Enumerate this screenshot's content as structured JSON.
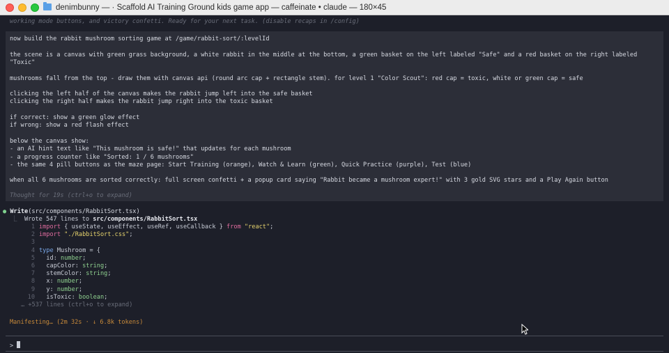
{
  "window": {
    "title": "denimbunny — · Scaffold AI Training Ground kids game app — caffeinate • claude — 180×45"
  },
  "terminal": {
    "top_line": "working mode buttons, and victory confetti. Ready for your next task. (disable recaps in /config)",
    "prompt_lines": [
      "now build the rabbit mushroom sorting game at /game/rabbit-sort/:levelId",
      "",
      "the scene is a canvas with green grass background, a white rabbit in the middle at the bottom, a green basket on the left labeled \"Safe\" and a red basket on the right labeled",
      "\"Toxic\"",
      "",
      "mushrooms fall from the top - draw them with canvas api (round arc cap + rectangle stem). for level 1 \"Color Scout\": red cap = toxic, white or green cap = safe",
      "",
      "clicking the left half of the canvas makes the rabbit jump left into the safe basket",
      "clicking the right half makes the rabbit jump right into the toxic basket",
      "",
      "if correct: show a green glow effect",
      "if wrong: show a red flash effect",
      "",
      "below the canvas show:",
      "- an AI hint text like \"This mushroom is safe!\" that updates for each mushroom",
      "- a progress counter like \"Sorted: 1 / 6 mushrooms\"",
      "- the same 4 pill buttons as the maze page: Start Training (orange), Watch & Learn (green), Quick Practice (purple), Test (blue)",
      "",
      "when all 6 mushrooms are sorted correctly: full screen confetti + a popup card saying \"Rabbit became a mushroom expert!\" with 3 gold SVG stars and a Play Again button"
    ],
    "thought": "Thought for 19s (ctrl+o to expand)",
    "tool_call": {
      "name": "Write",
      "arg": "(src/components/RabbitSort.tsx)",
      "result_prefix": "Wrote 547 lines to ",
      "result_file": "src/components/RabbitSort.tsx"
    },
    "code_lines": [
      {
        "n": "1",
        "parts": [
          [
            "kw-import",
            "import"
          ],
          [
            "prop",
            " { useState, useEffect, useRef, useCallback } "
          ],
          [
            "kw-from",
            "from"
          ],
          [
            "str",
            " \"react\""
          ],
          [
            "prop",
            ";"
          ]
        ]
      },
      {
        "n": "2",
        "parts": [
          [
            "kw-import",
            "import"
          ],
          [
            "str",
            " \"./RabbitSort.css\""
          ],
          [
            "prop",
            ";"
          ]
        ]
      },
      {
        "n": "3",
        "parts": []
      },
      {
        "n": "4",
        "parts": [
          [
            "type-kw",
            "type"
          ],
          [
            "prop",
            " Mushroom = {"
          ]
        ]
      },
      {
        "n": "5",
        "parts": [
          [
            "prop",
            "  id: "
          ],
          [
            "type",
            "number"
          ],
          [
            "prop",
            ";"
          ]
        ]
      },
      {
        "n": "6",
        "parts": [
          [
            "prop",
            "  capColor: "
          ],
          [
            "type",
            "string"
          ],
          [
            "prop",
            ";"
          ]
        ]
      },
      {
        "n": "7",
        "parts": [
          [
            "prop",
            "  stemColor: "
          ],
          [
            "type",
            "string"
          ],
          [
            "prop",
            ";"
          ]
        ]
      },
      {
        "n": "8",
        "parts": [
          [
            "prop",
            "  x: "
          ],
          [
            "type",
            "number"
          ],
          [
            "prop",
            ";"
          ]
        ]
      },
      {
        "n": "9",
        "parts": [
          [
            "prop",
            "  y: "
          ],
          [
            "type",
            "number"
          ],
          [
            "prop",
            ";"
          ]
        ]
      },
      {
        "n": "10",
        "parts": [
          [
            "prop",
            "  isToxic: "
          ],
          [
            "type",
            "boolean"
          ],
          [
            "prop",
            ";"
          ]
        ]
      }
    ],
    "more_lines": "… +537 lines (ctrl+o to expand)",
    "status": "Manifesting… (2m 32s · ↓ 6.8k tokens)",
    "input_prompt": ">"
  }
}
